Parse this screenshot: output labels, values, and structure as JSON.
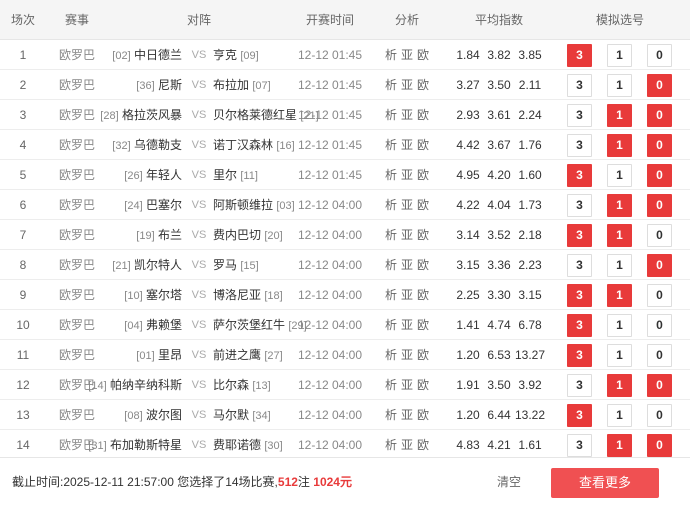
{
  "headers": {
    "num": "场次",
    "league": "赛事",
    "match": "对阵",
    "time": "开赛时间",
    "analysis": "分析",
    "odds": "平均指数",
    "pick": "模拟选号"
  },
  "analysis_labels": [
    "析",
    "亚",
    "欧"
  ],
  "vs_label": "VS",
  "pick_labels": [
    "3",
    "1",
    "0"
  ],
  "accent_color": "#e83a3a",
  "matches": [
    {
      "num": "1",
      "league": "欧罗巴",
      "home_rank": "[02]",
      "home": "中日德兰",
      "away": "亨克",
      "away_rank": "[09]",
      "time": "12-12 01:45",
      "odds": [
        "1.84",
        "3.82",
        "3.85"
      ],
      "selected": [
        "3"
      ]
    },
    {
      "num": "2",
      "league": "欧罗巴",
      "home_rank": "[36]",
      "home": "尼斯",
      "away": "布拉加",
      "away_rank": "[07]",
      "time": "12-12 01:45",
      "odds": [
        "3.27",
        "3.50",
        "2.11"
      ],
      "selected": [
        "0"
      ]
    },
    {
      "num": "3",
      "league": "欧罗巴",
      "home_rank": "[28]",
      "home": "格拉茨风暴",
      "away": "贝尔格莱德红星",
      "away_rank": "[21]",
      "time": "12-12 01:45",
      "odds": [
        "2.93",
        "3.61",
        "2.24"
      ],
      "selected": [
        "1",
        "0"
      ]
    },
    {
      "num": "4",
      "league": "欧罗巴",
      "home_rank": "[32]",
      "home": "乌德勒支",
      "away": "诺丁汉森林",
      "away_rank": "[16]",
      "time": "12-12 01:45",
      "odds": [
        "4.42",
        "3.67",
        "1.76"
      ],
      "selected": [
        "1",
        "0"
      ]
    },
    {
      "num": "5",
      "league": "欧罗巴",
      "home_rank": "[26]",
      "home": "年轻人",
      "away": "里尔",
      "away_rank": "[11]",
      "time": "12-12 01:45",
      "odds": [
        "4.95",
        "4.20",
        "1.60"
      ],
      "selected": [
        "3",
        "0"
      ]
    },
    {
      "num": "6",
      "league": "欧罗巴",
      "home_rank": "[24]",
      "home": "巴塞尔",
      "away": "阿斯顿维拉",
      "away_rank": "[03]",
      "time": "12-12 04:00",
      "odds": [
        "4.22",
        "4.04",
        "1.73"
      ],
      "selected": [
        "1",
        "0"
      ]
    },
    {
      "num": "7",
      "league": "欧罗巴",
      "home_rank": "[19]",
      "home": "布兰",
      "away": "费内巴切",
      "away_rank": "[20]",
      "time": "12-12 04:00",
      "odds": [
        "3.14",
        "3.52",
        "2.18"
      ],
      "selected": [
        "3",
        "1"
      ]
    },
    {
      "num": "8",
      "league": "欧罗巴",
      "home_rank": "[21]",
      "home": "凯尔特人",
      "away": "罗马",
      "away_rank": "[15]",
      "time": "12-12 04:00",
      "odds": [
        "3.15",
        "3.36",
        "2.23"
      ],
      "selected": [
        "0"
      ]
    },
    {
      "num": "9",
      "league": "欧罗巴",
      "home_rank": "[10]",
      "home": "塞尔塔",
      "away": "博洛尼亚",
      "away_rank": "[18]",
      "time": "12-12 04:00",
      "odds": [
        "2.25",
        "3.30",
        "3.15"
      ],
      "selected": [
        "3",
        "1"
      ]
    },
    {
      "num": "10",
      "league": "欧罗巴",
      "home_rank": "[04]",
      "home": "弗赖堡",
      "away": "萨尔茨堡红牛",
      "away_rank": "[29]",
      "time": "12-12 04:00",
      "odds": [
        "1.41",
        "4.74",
        "6.78"
      ],
      "selected": [
        "3"
      ]
    },
    {
      "num": "11",
      "league": "欧罗巴",
      "home_rank": "[01]",
      "home": "里昂",
      "away": "前进之鹰",
      "away_rank": "[27]",
      "time": "12-12 04:00",
      "odds": [
        "1.20",
        "6.53",
        "13.27"
      ],
      "selected": [
        "3"
      ]
    },
    {
      "num": "12",
      "league": "欧罗巴",
      "home_rank": "[14]",
      "home": "帕纳辛纳科斯",
      "away": "比尔森",
      "away_rank": "[13]",
      "time": "12-12 04:00",
      "odds": [
        "1.91",
        "3.50",
        "3.92"
      ],
      "selected": [
        "1",
        "0"
      ]
    },
    {
      "num": "13",
      "league": "欧罗巴",
      "home_rank": "[08]",
      "home": "波尔图",
      "away": "马尔默",
      "away_rank": "[34]",
      "time": "12-12 04:00",
      "odds": [
        "1.20",
        "6.44",
        "13.22"
      ],
      "selected": [
        "3"
      ]
    },
    {
      "num": "14",
      "league": "欧罗巴",
      "home_rank": "[31]",
      "home": "布加勒斯特星",
      "away": "费耶诺德",
      "away_rank": "[30]",
      "time": "12-12 04:00",
      "odds": [
        "4.83",
        "4.21",
        "1.61"
      ],
      "selected": [
        "1",
        "0"
      ]
    }
  ],
  "footer": {
    "deadline_text": "截止时间:2025-12-11 21:57:00 您选择了14场比赛,",
    "bets": "512",
    "bets_unit": "注",
    "amount": "1024元",
    "clear_label": "清空",
    "more_label": "查看更多"
  }
}
